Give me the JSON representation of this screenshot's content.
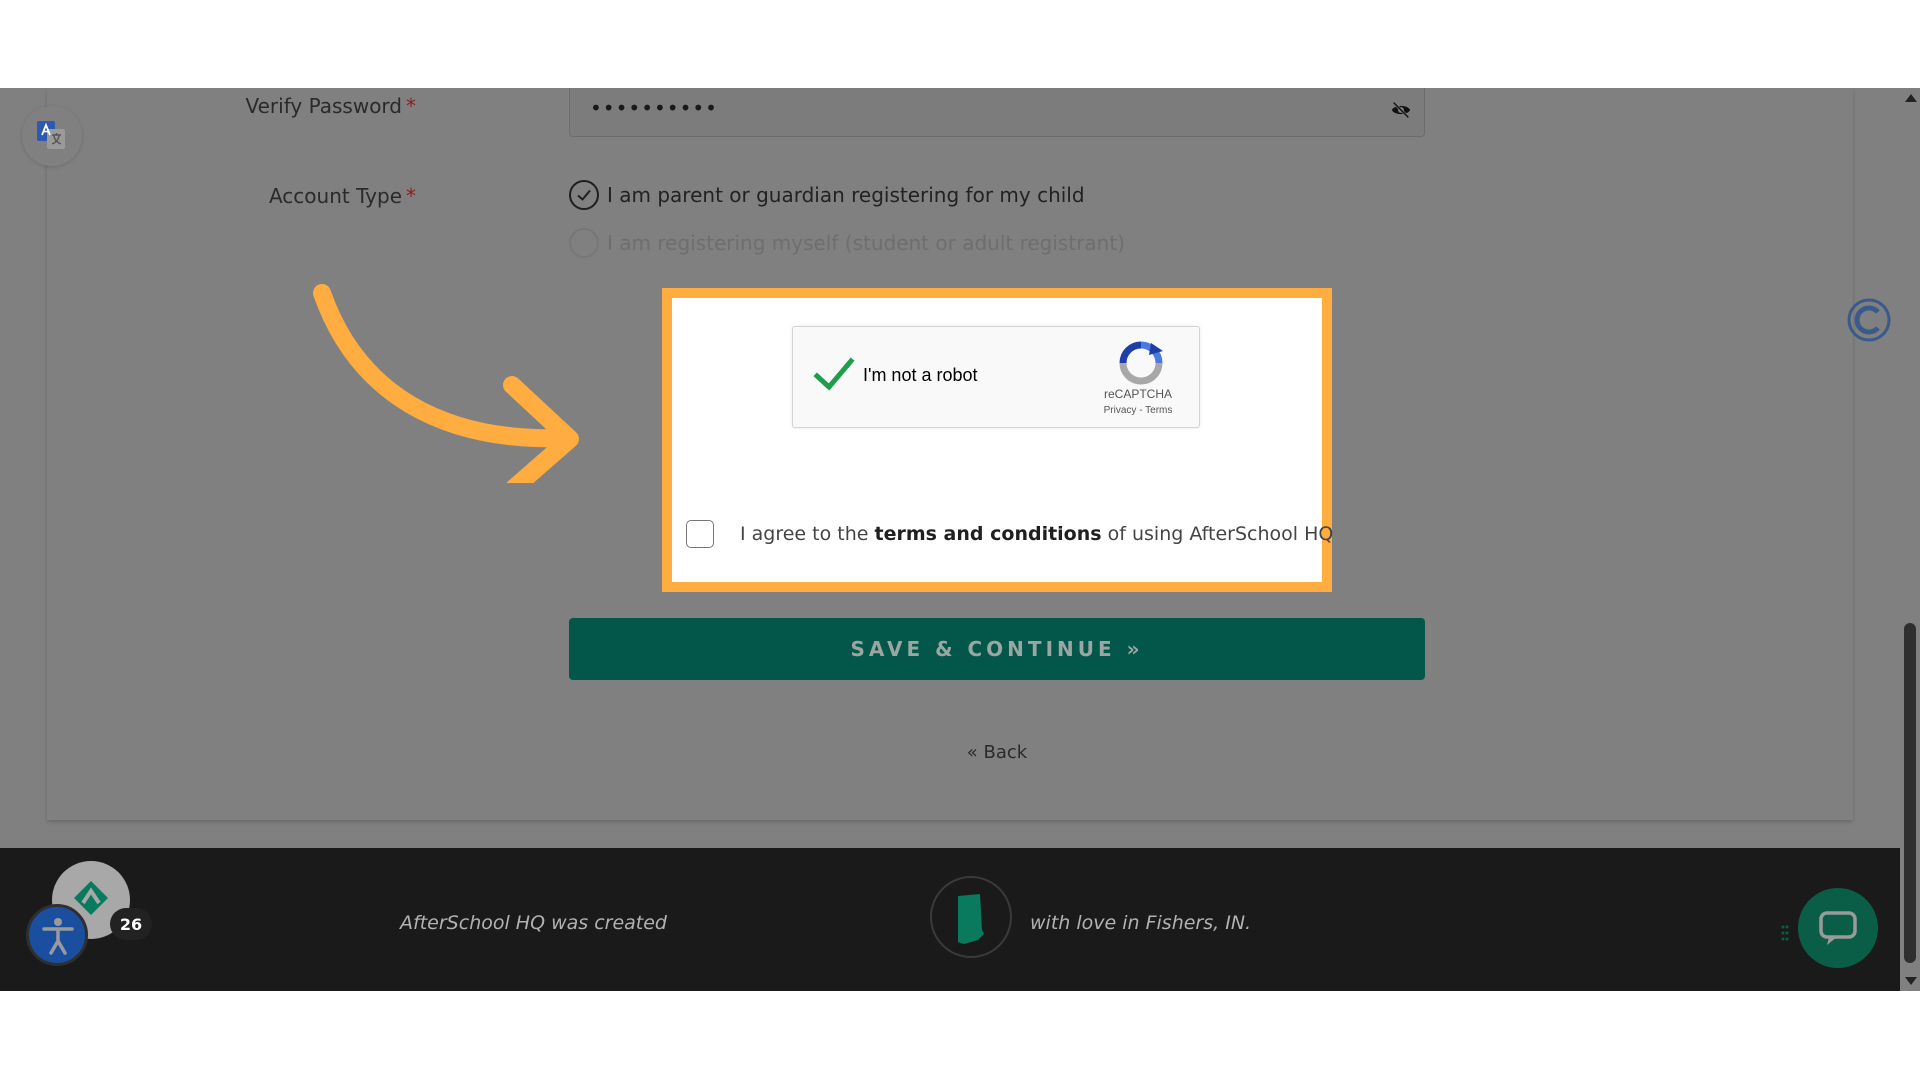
{
  "form": {
    "verify_password_label": "Verify Password",
    "required_marker": "*",
    "verify_password_value": "••••••••••",
    "account_type_label": "Account Type",
    "account_type_options": [
      {
        "label": "I am parent or guardian registering for my child",
        "selected": true
      },
      {
        "label": "I am registering myself (student or adult registrant)",
        "selected": false
      }
    ]
  },
  "recaptcha": {
    "label": "I'm not a robot",
    "checked": true,
    "brand": "reCAPTCHA",
    "privacy": "Privacy",
    "separator": " - ",
    "terms": "Terms"
  },
  "agreement": {
    "checked": false,
    "prefix": "I agree to the ",
    "link": "terms and conditions",
    "suffix": " of using AfterSchool HQ"
  },
  "actions": {
    "save_label": "SAVE & CONTINUE »",
    "back_label": "« Back"
  },
  "footer": {
    "text_left": "AfterSchool HQ was created",
    "text_right": "with love in Fishers, IN."
  },
  "widgets": {
    "notification_count": "26"
  },
  "colors": {
    "highlight": "#ffac40",
    "primary": "#02574a",
    "footer_bg": "#1a1a1a",
    "accessibility": "#1a4fa0",
    "chat": "#0a5e47",
    "overlay": "#808080"
  },
  "icons": [
    "eye-off-icon",
    "check-circle-icon",
    "recaptcha-logo-icon",
    "google-translate-icon",
    "c-logo-icon",
    "indiana-state-icon",
    "afterschool-logo-icon",
    "accessibility-icon",
    "chat-icon",
    "arrow-annotation-icon"
  ]
}
